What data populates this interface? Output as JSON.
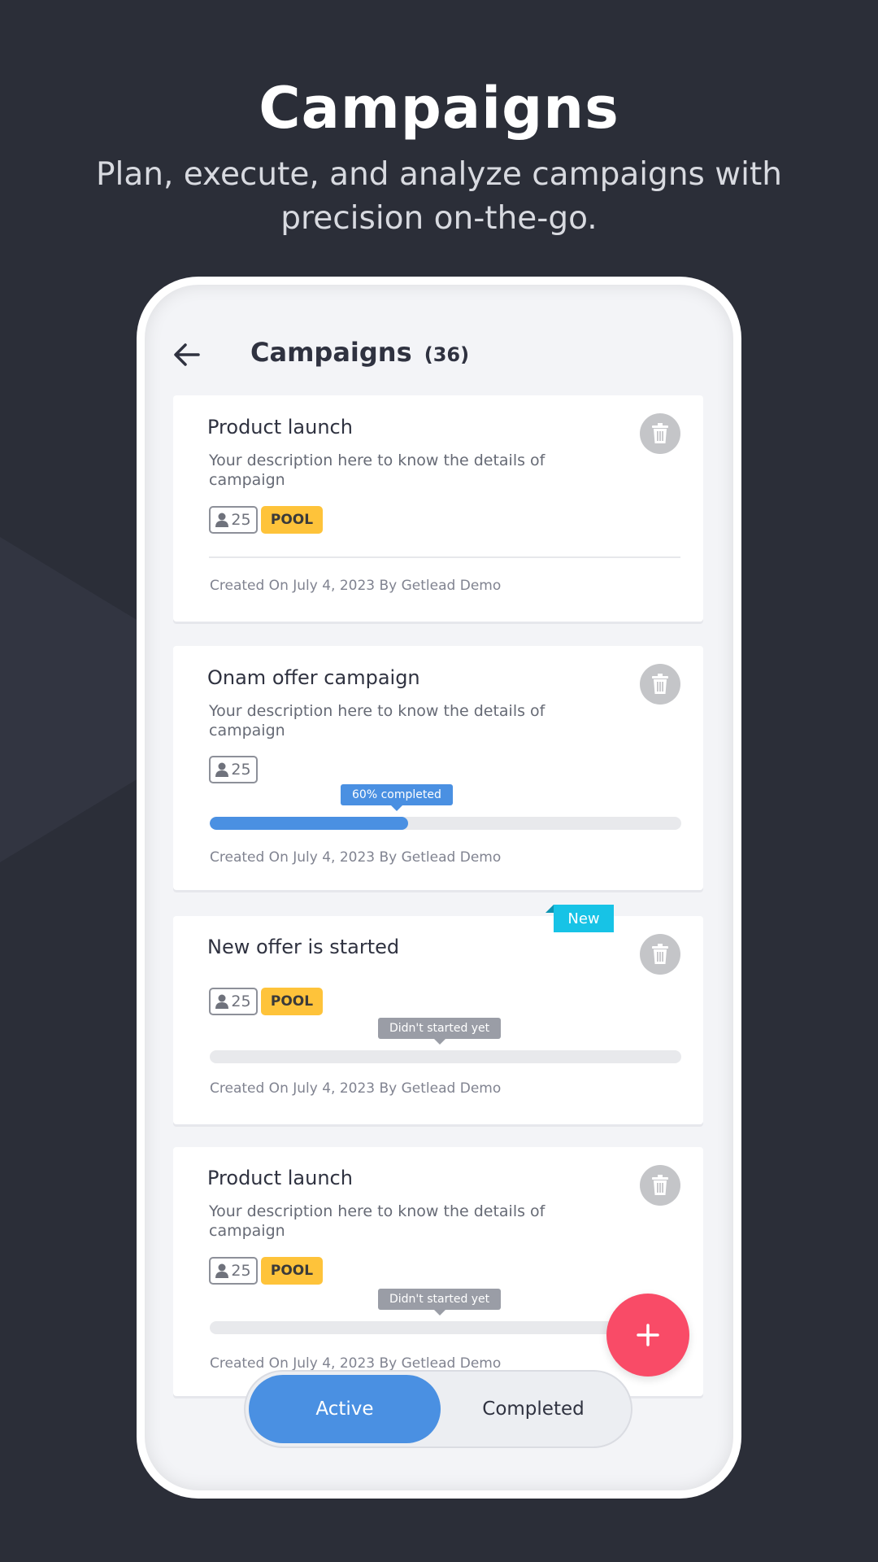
{
  "marketing": {
    "headline": "Campaigns",
    "subline": "Plan, execute, and analyze campaigns with precision on-the-go."
  },
  "header": {
    "title": "Campaigns",
    "count": "(36)",
    "back_icon": "arrow-left-icon"
  },
  "colors": {
    "primary": "#4a90e2",
    "pool_badge": "#fec33a",
    "fab": "#f94b67",
    "new_ribbon": "#17c3e6",
    "background": "#2b2e38"
  },
  "campaigns": [
    {
      "title": "Product launch",
      "description": "Your description here to know the details of campaign",
      "members": "25",
      "pool": "POOL",
      "footer": "Created On July 4, 2023 By Getlead Demo"
    },
    {
      "title": "Onam offer campaign",
      "description": "Your description here to know the details of campaign",
      "members": "25",
      "progress_label": "60% completed",
      "progress_value": 0.42,
      "footer": "Created On July 4, 2023 By Getlead Demo"
    },
    {
      "title": "New offer is started",
      "ribbon": "New",
      "members": "25",
      "pool": "POOL",
      "progress_label": "Didn't started yet",
      "progress_value": 0,
      "footer": "Created On July 4, 2023 By Getlead Demo"
    },
    {
      "title": "Product launch",
      "description": "Your description here to know the details of campaign",
      "members": "25",
      "pool": "POOL",
      "progress_label": "Didn't started yet",
      "progress_value": 0,
      "footer": "Created On July 4, 2023 By Getlead Demo"
    }
  ],
  "tabs": {
    "active": "Active",
    "completed": "Completed"
  },
  "fab_icon": "plus-icon",
  "trash_icon": "trash-icon",
  "member_icon": "person-icon"
}
